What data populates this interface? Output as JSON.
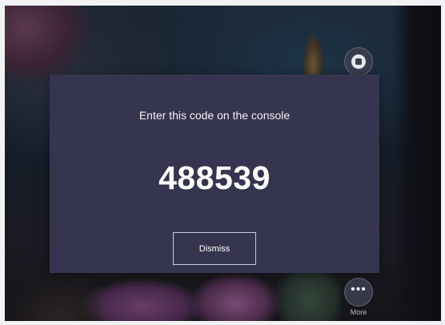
{
  "dialog": {
    "title": "Enter this code on the console",
    "code": "488539",
    "dismiss_label": "Dismiss"
  },
  "side_controls": {
    "camera_icon": "camera-icon",
    "more_icon": "more-icon",
    "more_label": "More"
  },
  "colors": {
    "dialog_background": "#36354f",
    "button_border": "#c9c6ee",
    "text": "#ffffff"
  }
}
